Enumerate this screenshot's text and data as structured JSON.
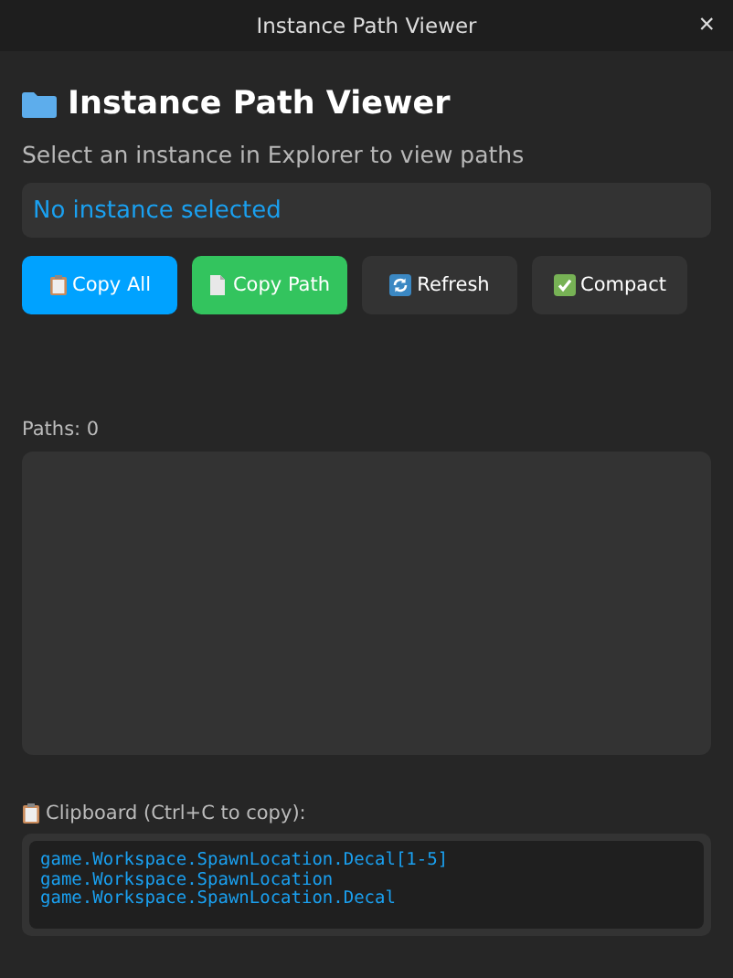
{
  "window": {
    "title": "Instance Path Viewer",
    "close": "×"
  },
  "header": {
    "title": "Instance Path Viewer",
    "subtitle": "Select an instance in Explorer to view paths"
  },
  "instance_field": {
    "value": "No instance selected"
  },
  "buttons": [
    {
      "label": "Copy All",
      "kind": "clipboard",
      "color": "#00a2ff"
    },
    {
      "label": "Copy Path",
      "kind": "document",
      "color": "#33c45e"
    },
    {
      "label": "Refresh",
      "kind": "refresh",
      "color": "#333333"
    },
    {
      "label": "Compact",
      "kind": "check",
      "color": "#333333"
    }
  ],
  "paths": {
    "count_label": "Paths: 0"
  },
  "clipboard": {
    "label": "Clipboard (Ctrl+C to copy):",
    "lines": [
      "game.Workspace.SpawnLocation.Decal[1-5]",
      "game.Workspace.SpawnLocation",
      "game.Workspace.SpawnLocation.Decal"
    ]
  }
}
